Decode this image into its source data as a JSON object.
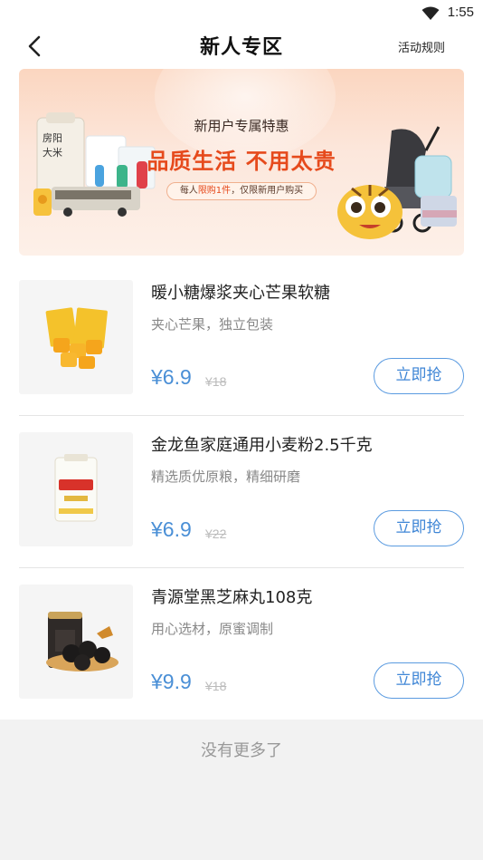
{
  "status_bar": {
    "time": "1:55"
  },
  "nav": {
    "title": "新人专区",
    "rules_label": "活动规则"
  },
  "banner": {
    "subtitle": "新用户专属特惠",
    "title": "品质生活 不用太贵",
    "pill_prefix": "每人",
    "pill_highlight": "限购1件",
    "pill_suffix": "，仅限新用户购买",
    "art_texts": [
      "房阳",
      "大米"
    ]
  },
  "products": [
    {
      "name": "暖小糖爆浆夹心芒果软糖",
      "desc": "夹心芒果，独立包装",
      "price": "¥6.9",
      "original_price": "¥18",
      "button": "立即抢",
      "image": "mango-candy-image"
    },
    {
      "name": "金龙鱼家庭通用小麦粉2.5千克",
      "desc": "精选质优原粮，精细研磨",
      "price": "¥6.9",
      "original_price": "¥22",
      "button": "立即抢",
      "image": "flour-bag-image"
    },
    {
      "name": "青源堂黑芝麻丸108克",
      "desc": "用心选材，原蜜调制",
      "price": "¥9.9",
      "original_price": "¥18",
      "button": "立即抢",
      "image": "sesame-balls-image"
    }
  ],
  "footer": {
    "end_text": "没有更多了"
  },
  "colors": {
    "accent": "#4a8fd6",
    "banner_title": "#e64a1c",
    "background": "#f2f2f2"
  }
}
